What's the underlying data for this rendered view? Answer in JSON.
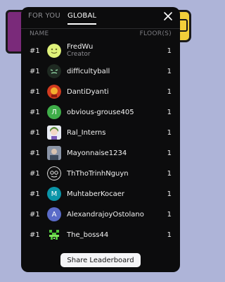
{
  "tabs": [
    {
      "label": "FOR YOU",
      "active": false
    },
    {
      "label": "GLOBAL",
      "active": true
    }
  ],
  "columns": {
    "name": "NAME",
    "floors": "FLOOR(S)"
  },
  "entries": [
    {
      "rank": "#1",
      "name": "FredWu",
      "subtitle": "Creator",
      "floors": "1",
      "avatar": "smiley-avatar"
    },
    {
      "rank": "#1",
      "name": "difficultyball",
      "floors": "1",
      "avatar": "ball-face-avatar"
    },
    {
      "rank": "#1",
      "name": "DantiDyanti",
      "floors": "1",
      "avatar": "photo-avatar"
    },
    {
      "rank": "#1",
      "name": "obvious-grouse405",
      "floors": "1",
      "avatar": "letter-avatar",
      "letter": "Л",
      "color": "#3fae49"
    },
    {
      "rank": "#1",
      "name": "Ral_Interns",
      "floors": "1",
      "avatar": "anime-avatar"
    },
    {
      "rank": "#1",
      "name": "Mayonnaise1234",
      "floors": "1",
      "avatar": "photo-avatar"
    },
    {
      "rank": "#1",
      "name": "ThThoTrinhNguyn",
      "floors": "1",
      "avatar": "pattern-avatar"
    },
    {
      "rank": "#1",
      "name": "MuhtaberKocaer",
      "floors": "1",
      "avatar": "letter-avatar",
      "letter": "M",
      "color": "#0a95a8"
    },
    {
      "rank": "#1",
      "name": "AlexandrajoyOstolano",
      "floors": "1",
      "avatar": "letter-avatar",
      "letter": "A",
      "color": "#5a6bc8"
    },
    {
      "rank": "#1",
      "name": "The_boss44",
      "floors": "1",
      "avatar": "pixel-creeper-avatar"
    }
  ],
  "share_button": "Share Leaderboard",
  "colors": {
    "page_bg": "#aeb4d8",
    "modal_bg": "#0c0c0d",
    "muted": "#8e8e93"
  }
}
